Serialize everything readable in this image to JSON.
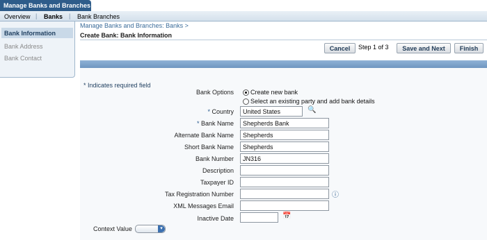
{
  "app": {
    "title": "Manage Banks and Branches"
  },
  "nav": {
    "tabs": [
      "Overview",
      "Banks",
      "Bank Branches"
    ]
  },
  "sidebar": {
    "items": [
      "Bank Information",
      "Bank Address",
      "Bank Contact"
    ]
  },
  "breadcrumb": "Manage Banks and Branches: Banks  >",
  "page_title": "Create Bank: Bank Information",
  "toolbar": {
    "cancel": "Cancel",
    "step": "Step 1 of 3",
    "save_next": "Save and Next",
    "finish": "Finish"
  },
  "required_note": "* Indicates required field",
  "form": {
    "bank_options_label": "Bank Options",
    "option_new": "Create new bank",
    "option_existing": "Select an existing party and add bank details",
    "country_label": "Country",
    "country_value": "United States",
    "bank_name_label": "Bank Name",
    "bank_name_value": "Shepherds Bank",
    "alt_bank_name_label": "Alternate Bank Name",
    "alt_bank_name_value": "Shepherds",
    "short_bank_name_label": "Short Bank Name",
    "short_bank_name_value": "Shepherds",
    "bank_number_label": "Bank Number",
    "bank_number_value": "JN316",
    "description_label": "Description",
    "description_value": "",
    "taxpayer_id_label": "Taxpayer ID",
    "taxpayer_id_value": "",
    "tax_reg_label": "Tax Registration Number",
    "tax_reg_value": "",
    "xml_email_label": "XML Messages Email",
    "xml_email_value": "",
    "inactive_date_label": "Inactive Date",
    "inactive_date_value": "",
    "context_value_label": "Context Value"
  },
  "icons": {
    "country_search": "search-icon",
    "tax_reg_info": "info-icon",
    "calendar": "calendar-icon"
  }
}
